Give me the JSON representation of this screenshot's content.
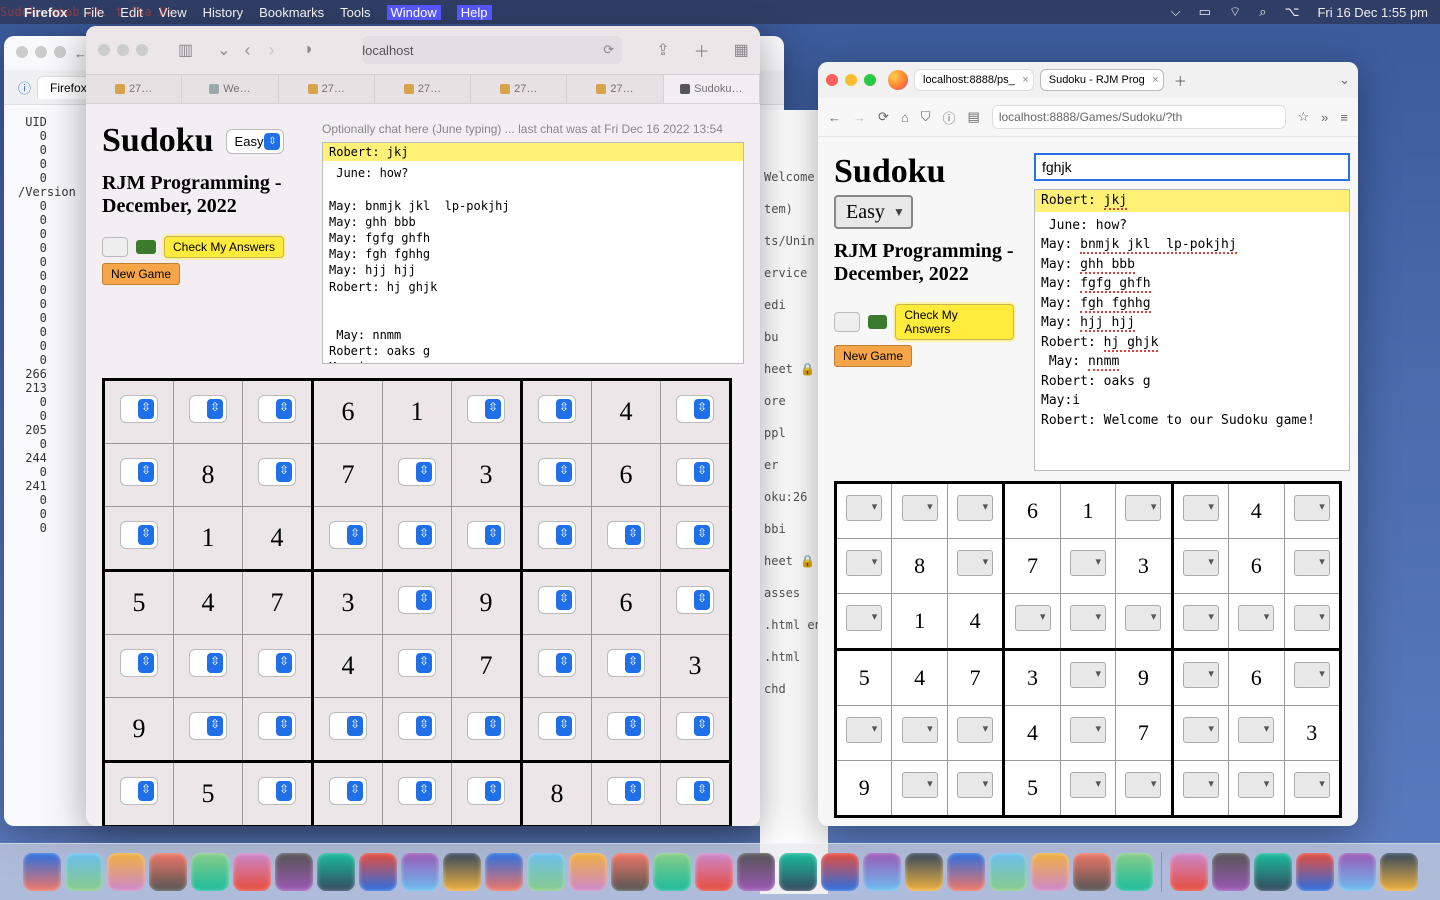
{
  "menubar": {
    "app": "Firefox",
    "items": [
      "File",
      "Edit",
      "View",
      "History",
      "Bookmarks",
      "Tools",
      "Window",
      "Help"
    ],
    "clock": "Fri 16 Dec  1:55 pm"
  },
  "topred": "Sudoku     atab   at.   t Cha  Na",
  "safari": {
    "address": "localhost",
    "tabs": [
      "27…",
      "We…",
      "27…",
      "27…",
      "27…",
      "27…",
      "Sudoku…"
    ],
    "title": "Sudoku",
    "difficulty": "Easy",
    "chat_hint": "Optionally chat here (June typing) ... last chat was at Fri Dec 16 2022 13:54",
    "subtitle": "RJM Programming - December, 2022",
    "check_btn": "Check My Answers",
    "newgame_btn": "New Game",
    "chat_first": "Robert: jkj",
    "chat_body": " June: how?\n\nMay: bnmjk jkl  lp-pokjhj\nMay: ghh bbb\nMay: fgfg ghfh\nMay: fgh fghhg\nMay: hjj hjj\nRobert: hj ghjk\n\n\n May: nnmm\nRobert: oaks g\nMay:i\n\nRobert: Welcome to our Sudoku game!",
    "board": [
      [
        "",
        "",
        "",
        "6",
        "1",
        "",
        "",
        "4",
        ""
      ],
      [
        "",
        "8",
        "",
        "7",
        "",
        "3",
        "",
        "6",
        ""
      ],
      [
        "",
        "1",
        "4",
        "",
        "",
        "",
        "",
        "",
        ""
      ],
      [
        "5",
        "4",
        "7",
        "3",
        "",
        "9",
        "",
        "6",
        ""
      ],
      [
        "",
        "",
        "",
        "4",
        "",
        "7",
        "",
        "",
        "3"
      ],
      [
        "9",
        "",
        "",
        "",
        "",
        "",
        "",
        "",
        ""
      ],
      [
        "",
        "5",
        "",
        "",
        "",
        "",
        "8",
        "",
        ""
      ]
    ]
  },
  "foxback": {
    "tab_label": "Firefox p",
    "body": " UID\n   0\n   0\n   0\n   0\n/Version\n   0\n   0\n   0\n   0\n   0\n   0\n   0\n   0\n   0\n   0\n   0\n   0\n 266\n 213\n   0\n   0\n 205\n   0\n 244\n   0\n 241\n   0\n   0\n   0"
  },
  "frag_lines": [
    "Welcome",
    "tem)",
    "ts/Unin",
    "ervice",
    "edi",
    "bu",
    "heet 🔒",
    "ore",
    "ppl",
    "er",
    "oku:26",
    "bbi",
    "heet 🔒",
    "asses",
    ".html  ene",
    ".html",
    "chd"
  ],
  "foxright": {
    "tabs": [
      "localhost:8888/ps_",
      "Sudoku - RJM Prog"
    ],
    "url": "localhost:8888/Games/Sudoku/?th",
    "title": "Sudoku",
    "difficulty": "Easy",
    "input_value": "fghjk ",
    "subtitle": "RJM Programming - December, 2022",
    "check_btn": "Check My Answers",
    "newgame_btn": "New Game",
    "chat_first": "Robert: ",
    "chat_first_misp": "jkj",
    "chat_lines": [
      {
        "pre": " June: how?",
        "misp": ""
      },
      {
        "pre": "",
        "misp": ""
      },
      {
        "pre": "May: ",
        "misp": "bnmjk jkl  lp-pokjhj"
      },
      {
        "pre": "May: ",
        "misp": "ghh bbb"
      },
      {
        "pre": "May: ",
        "misp": "fgfg ghfh"
      },
      {
        "pre": "May: ",
        "misp": "fgh fghhg"
      },
      {
        "pre": "May: ",
        "misp": "hjj hjj"
      },
      {
        "pre": "Robert: ",
        "misp": "hj ghjk"
      },
      {
        "pre": "",
        "misp": ""
      },
      {
        "pre": "",
        "misp": ""
      },
      {
        "pre": " May: ",
        "misp": "nnmm"
      },
      {
        "pre": "Robert: oaks g",
        "misp": ""
      },
      {
        "pre": "May:i",
        "misp": ""
      },
      {
        "pre": "",
        "misp": ""
      },
      {
        "pre": "Robert: Welcome to our Sudoku game!",
        "misp": ""
      }
    ],
    "board": [
      [
        "",
        "",
        "",
        "6",
        "1",
        "",
        "",
        "4",
        ""
      ],
      [
        "",
        "8",
        "",
        "7",
        "",
        "3",
        "",
        "6",
        ""
      ],
      [
        "",
        "1",
        "4",
        "",
        "",
        "",
        "",
        "",
        ""
      ],
      [
        "5",
        "4",
        "7",
        "3",
        "",
        "9",
        "",
        "6",
        ""
      ],
      [
        "",
        "",
        "",
        "4",
        "",
        "7",
        "",
        "",
        "3"
      ],
      [
        "9",
        "",
        "",
        "5",
        "",
        "",
        "",
        "",
        ""
      ]
    ]
  },
  "dock_count": 33
}
